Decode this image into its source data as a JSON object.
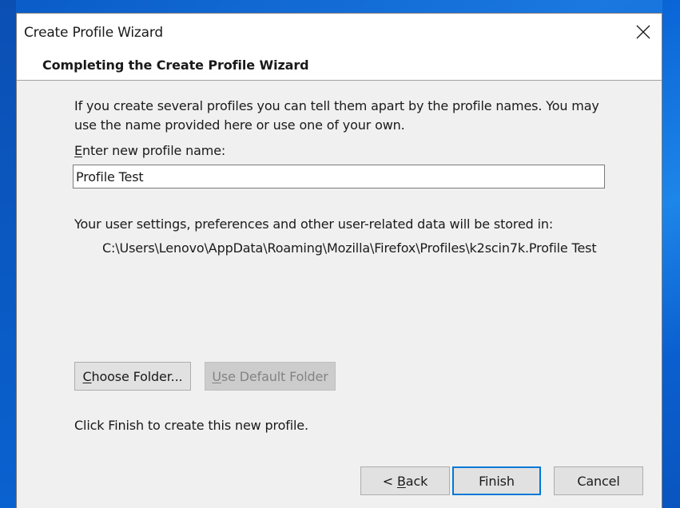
{
  "window": {
    "title": "Create Profile Wizard",
    "header_title": "Completing the Create Profile Wizard"
  },
  "content": {
    "description": "If you create several profiles you can tell them apart by the profile names. You may use the name provided here or use one of your own.",
    "name_label_mnemonic": "E",
    "name_label_rest": "nter new profile name:",
    "profile_name_value": "Profile Test",
    "storage_label": "Your user settings, preferences and other user-related data will be stored in:",
    "storage_path": "C:\\Users\\Lenovo\\AppData\\Roaming\\Mozilla\\Firefox\\Profiles\\k2scin7k.Profile Test",
    "finish_note": "Click Finish to create this new profile."
  },
  "buttons": {
    "choose_folder_mnemonic": "C",
    "choose_folder_rest": "hoose Folder...",
    "use_default_mnemonic": "U",
    "use_default_rest": "se Default Folder",
    "back_prefix": "< ",
    "back_mnemonic": "B",
    "back_rest": "ack",
    "finish": "Finish",
    "cancel": "Cancel"
  },
  "icons": {
    "close": "close-icon"
  },
  "colors": {
    "desktop": "#0a5cc8",
    "dialog_bg": "#f0f0f0",
    "default_button_border": "#0078d7"
  }
}
